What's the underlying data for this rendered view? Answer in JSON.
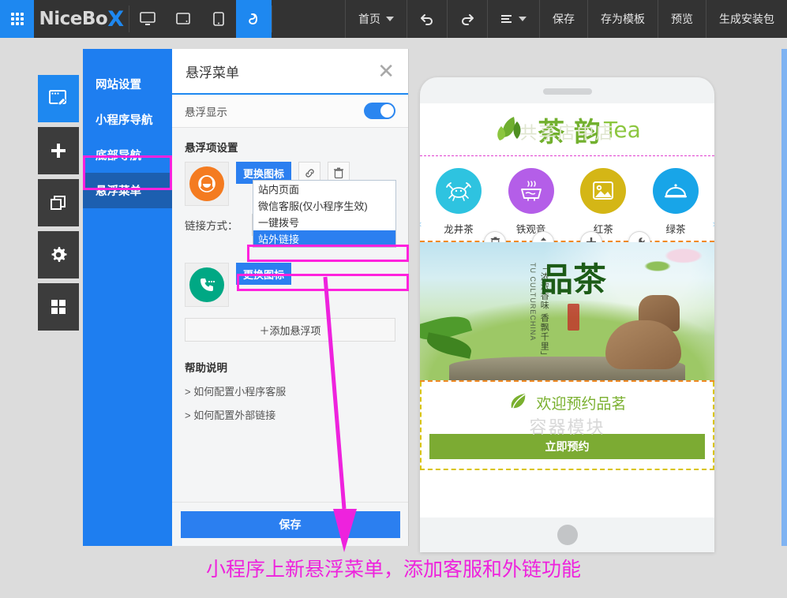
{
  "topbar": {
    "grid_icon": "app-grid-icon",
    "logo": "NiceBo",
    "logo_x": "X",
    "devices": [
      {
        "name": "desktop-view",
        "icon": "monitor-icon",
        "active": false
      },
      {
        "name": "tablet-view",
        "icon": "tablet-icon",
        "active": false
      },
      {
        "name": "mobile-view",
        "icon": "phone-icon",
        "active": false
      },
      {
        "name": "miniprogram-view",
        "icon": "wechat-miniprogram-icon",
        "active": true
      }
    ],
    "page_selector": "首页",
    "undo_icon": "undo-arrow-icon",
    "redo_icon": "redo-arrow-icon",
    "list_icon": "list-lines-icon",
    "actions": [
      "保存",
      "存为模板",
      "预览",
      "生成安装包"
    ]
  },
  "rail": [
    {
      "name": "page-edit",
      "icon": "page-edit-icon",
      "active": true
    },
    {
      "name": "add-module",
      "icon": "plus-icon",
      "active": false
    },
    {
      "name": "copy-page",
      "icon": "copy-icon",
      "active": false
    },
    {
      "name": "settings",
      "icon": "gear-icon",
      "active": false
    },
    {
      "name": "layout",
      "icon": "grid-layout-icon",
      "active": false
    }
  ],
  "submenu": {
    "items": [
      {
        "label": "网站设置",
        "selected": false
      },
      {
        "label": "小程序导航",
        "selected": false
      },
      {
        "label": "底部导航",
        "selected": false
      },
      {
        "label": "悬浮菜单",
        "selected": true
      }
    ]
  },
  "dialog": {
    "title": "悬浮菜单",
    "close_icon": "close-icon",
    "toggle": {
      "label": "悬浮显示",
      "on": true
    },
    "section_title": "悬浮项设置",
    "item1": {
      "icon": "customer-service-headset-icon",
      "icon_color": "#f47b20",
      "change_icon_label": "更换图标",
      "link_icon": "link-chain-icon",
      "delete_icon": "trash-icon"
    },
    "link_row": {
      "label": "链接方式：",
      "value": "站外链接",
      "chevron_icon": "chevron-down-icon"
    },
    "dropdown": {
      "options": [
        "站内页面",
        "微信客服(仅小程序生效)",
        "一键拨号",
        "站外链接"
      ],
      "selected": "站外链接",
      "highlighted": [
        "微信客服(仅小程序生效)",
        "站外链接"
      ]
    },
    "item2": {
      "icon": "phone-call-icon",
      "icon_color": "#00a884",
      "change_icon_label": "更换图标"
    },
    "add_item_label": "＋添加悬浮项",
    "help_title": "帮助说明",
    "help_links": [
      "> 如何配置小程序客服",
      "> 如何配置外部链接"
    ],
    "save_label": "保存",
    "scrollbar": "dialog-scrollbar"
  },
  "preview": {
    "speaker": "phone-speaker",
    "logo": {
      "cn": "茶 韵",
      "en": "Tea",
      "leaf_icon": "tea-leaf-icon",
      "ghost": "共享店中店"
    },
    "nav": [
      {
        "label": "龙井茶",
        "icon": "crab-icon",
        "color": "#2ec3e0"
      },
      {
        "label": "铁观音",
        "icon": "hotpot-bowl-icon",
        "color": "#b45ee8"
      },
      {
        "label": "红茶",
        "icon": "image-picture-icon",
        "color": "#d4b616"
      },
      {
        "label": "绿茶",
        "icon": "cloche-dish-icon",
        "color": "#18a5e8"
      }
    ],
    "arrow_left": "‹",
    "arrow_right": "›",
    "module_toolbar": [
      {
        "name": "delete-module",
        "icon": "trash-icon"
      },
      {
        "name": "move-module",
        "icon": "updown-arrows-icon"
      },
      {
        "name": "add-module",
        "icon": "plus-icon"
      },
      {
        "name": "settings-module",
        "icon": "wrench-icon"
      }
    ],
    "banner": {
      "title": "品茶",
      "subtitle": "茗",
      "vertical_text": "「浓浓香味 香飘千里」",
      "vertical_en": "TU CULTURECHINA",
      "alt": "tea-banner-image"
    },
    "bottom": {
      "welcome": "欢迎预约品茗",
      "leaf_icon": "green-leaf-icon",
      "ghost": "容器模块",
      "cta": "立即预约"
    },
    "home_button": "home-button"
  },
  "annotation": {
    "caption": "小程序上新悬浮菜单，添加客服和外链功能",
    "color": "#ee22dd",
    "arrow": "pink-pointer-arrow"
  }
}
